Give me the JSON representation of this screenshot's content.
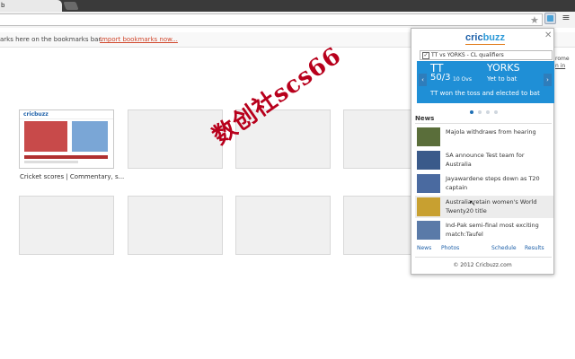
{
  "browser": {
    "tab_title": "b",
    "star_icon": "★",
    "menu_icon": "≡"
  },
  "bookmarks_bar": {
    "message": "arks here on the bookmarks bar.",
    "import_link": "Import bookmarks now...",
    "right_text_1": "rome",
    "right_text_2": "n in"
  },
  "new_tab": {
    "first_caption": "Cricket scores | Commentary, s...",
    "mini_logo": "cricbuzz"
  },
  "watermark": "数创社scs66",
  "popup": {
    "logo_cric": "cric",
    "logo_buzz": "buzz",
    "close": "✕",
    "match_selector": "TT vs YORKS - CL qualifiers",
    "team1": "TT",
    "score1": "50/3",
    "overs": "10 Ovs",
    "team2": "YORKS",
    "team2_status": "Yet to bat",
    "toss": "TT won the toss and elected to bat",
    "prev": "‹",
    "next": "›",
    "news_heading": "News",
    "news": [
      {
        "text": "Majola withdraws from hearing",
        "color": "#5a6e3a"
      },
      {
        "text": "SA announce Test team for Australia",
        "color": "#3a5a8a"
      },
      {
        "text": "Jayawardene steps down as T20 captain",
        "color": "#4a6aa0"
      },
      {
        "text": "Australia retain women's World Twenty20 title",
        "color": "#c8a030"
      },
      {
        "text": "Ind-Pak semi-final most exciting match:Taufel",
        "color": "#5a7aa8"
      }
    ],
    "links": {
      "news": "News",
      "photos": "Photos",
      "schedule": "Schedule",
      "results": "Results"
    },
    "footer": "© 2012 Cricbuzz.com"
  }
}
